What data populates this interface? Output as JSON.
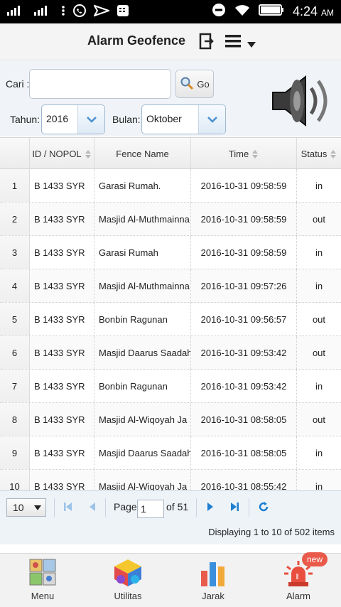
{
  "status_bar": {
    "time": "4:24",
    "ampm": "AM"
  },
  "header": {
    "title": "Alarm Geofence"
  },
  "search": {
    "label": "Cari :",
    "value": "",
    "go_label": "Go"
  },
  "filters": {
    "year_label": "Tahun:",
    "year_value": "2016",
    "month_label": "Bulan:",
    "month_value": "Oktober"
  },
  "table": {
    "columns": [
      "ID / NOPOL",
      "Fence Name",
      "Time",
      "Status"
    ],
    "rows": [
      {
        "no": "1",
        "id": "B 1433 SYR",
        "fence": "Garasi Rumah.",
        "time": "2016-10-31 09:58:59",
        "status": "in"
      },
      {
        "no": "2",
        "id": "B 1433 SYR",
        "fence": "Masjid Al-Muthmainna",
        "time": "2016-10-31 09:58:59",
        "status": "out"
      },
      {
        "no": "3",
        "id": "B 1433 SYR",
        "fence": "Garasi Rumah",
        "time": "2016-10-31 09:58:59",
        "status": "in"
      },
      {
        "no": "4",
        "id": "B 1433 SYR",
        "fence": "Masjid Al-Muthmainna",
        "time": "2016-10-31 09:57:26",
        "status": "in"
      },
      {
        "no": "5",
        "id": "B 1433 SYR",
        "fence": "Bonbin Ragunan",
        "time": "2016-10-31 09:56:57",
        "status": "out"
      },
      {
        "no": "6",
        "id": "B 1433 SYR",
        "fence": "Masjid Daarus Saadah",
        "time": "2016-10-31 09:53:42",
        "status": "out"
      },
      {
        "no": "7",
        "id": "B 1433 SYR",
        "fence": "Bonbin Ragunan",
        "time": "2016-10-31 09:53:42",
        "status": "in"
      },
      {
        "no": "8",
        "id": "B 1433 SYR",
        "fence": "Masjid Al-Wiqoyah Ja",
        "time": "2016-10-31 08:58:05",
        "status": "out"
      },
      {
        "no": "9",
        "id": "B 1433 SYR",
        "fence": "Masjid Daarus Saadah",
        "time": "2016-10-31 08:58:05",
        "status": "in"
      },
      {
        "no": "10",
        "id": "B 1433 SYR",
        "fence": "Masjid Al-Wiqoyah Ja",
        "time": "2016-10-31 08:55:42",
        "status": "in"
      }
    ]
  },
  "pager": {
    "page_size": "10",
    "page_label": "Page",
    "page_value": "1",
    "of_label": "of 51",
    "display_text": "Displaying 1 to 10 of 502 items"
  },
  "bottom_nav": {
    "items": [
      {
        "label": "Menu"
      },
      {
        "label": "Utilitas"
      },
      {
        "label": "Jarak"
      },
      {
        "label": "Alarm"
      }
    ],
    "badge": "new"
  },
  "colors": {
    "accent": "#1f7fd0",
    "badge": "#e95a4a"
  }
}
